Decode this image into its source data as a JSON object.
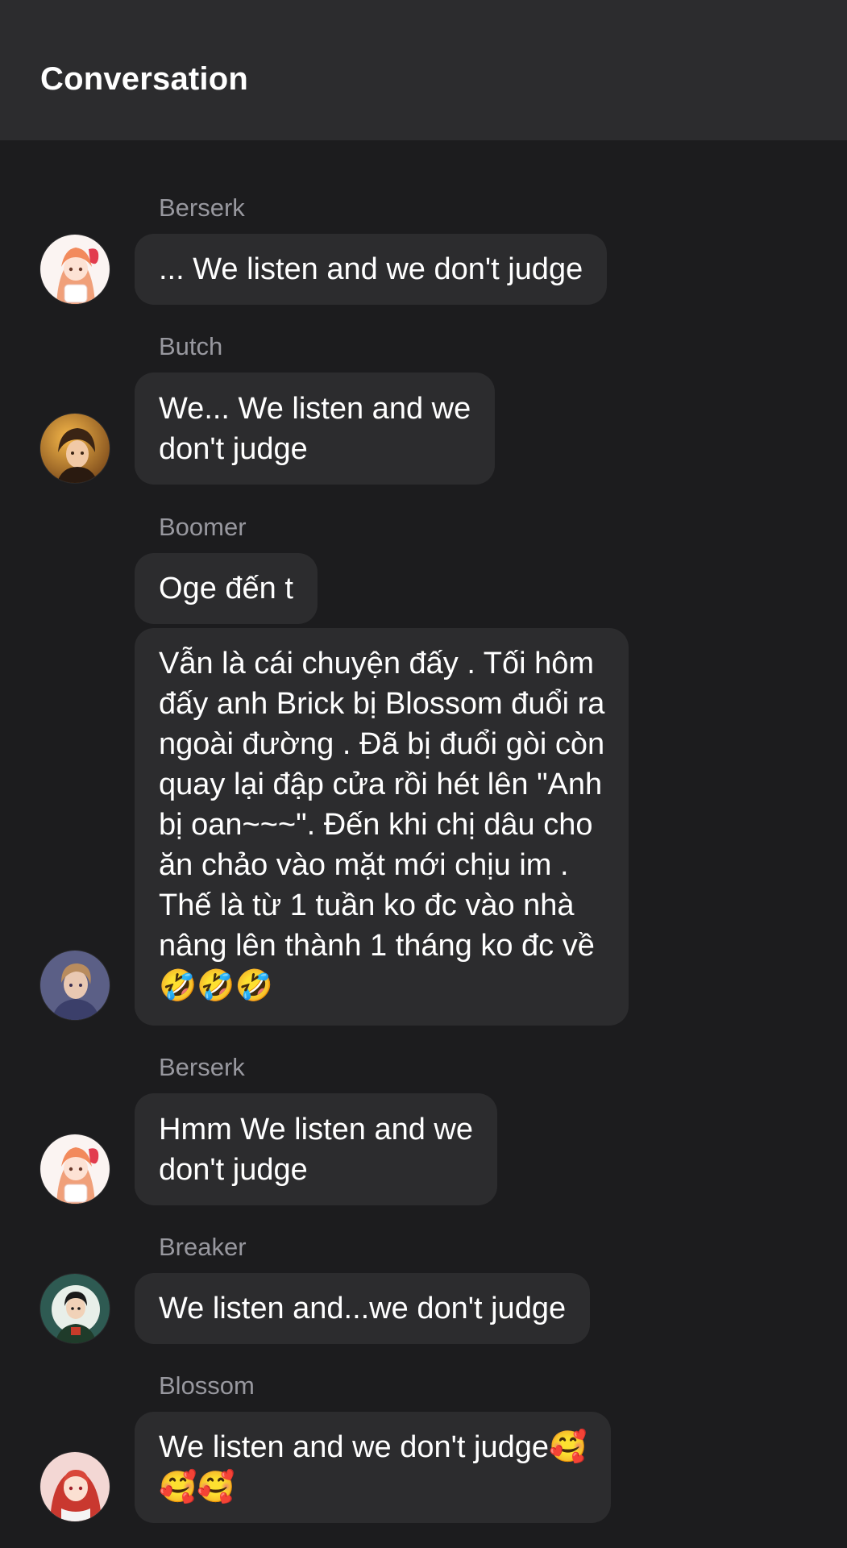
{
  "header": {
    "title": "Conversation"
  },
  "messages": [
    {
      "sender": "Berserk",
      "avatar": "berserk-avatar",
      "bubbles": [
        "... We listen and we don't judge"
      ]
    },
    {
      "sender": "Butch",
      "avatar": "butch-avatar",
      "bubbles": [
        "We... We listen and we\ndon't judge"
      ]
    },
    {
      "sender": "Boomer",
      "avatar": "boomer-avatar",
      "bubbles": [
        "Oge đến t",
        "Vẫn là cái chuyện đấy . Tối hôm\nđấy anh Brick bị Blossom đuổi ra\nngoài đường . Đã bị đuổi gòi còn\nquay lại đập cửa rồi hét lên \"Anh\nbị oan~~~\". Đến khi chị dâu cho\năn chảo vào mặt mới chịu im .\nThế là từ 1 tuần ko đc vào nhà\nnâng lên thành 1 tháng ko đc về\n🤣🤣🤣"
      ]
    },
    {
      "sender": "Berserk",
      "avatar": "berserk-avatar",
      "bubbles": [
        "Hmm We listen and we\ndon't judge"
      ]
    },
    {
      "sender": "Breaker",
      "avatar": "breaker-avatar",
      "bubbles": [
        "We listen and...we don't judge"
      ]
    },
    {
      "sender": "Blossom",
      "avatar": "blossom-avatar",
      "bubbles": [
        "We listen and we don't judge🥰\n🥰🥰"
      ]
    }
  ],
  "colors": {
    "background": "#1c1c1e",
    "header": "#2c2c2e",
    "bubble": "#2c2c2e",
    "sender_text": "#98989f",
    "message_text": "#ffffff"
  }
}
